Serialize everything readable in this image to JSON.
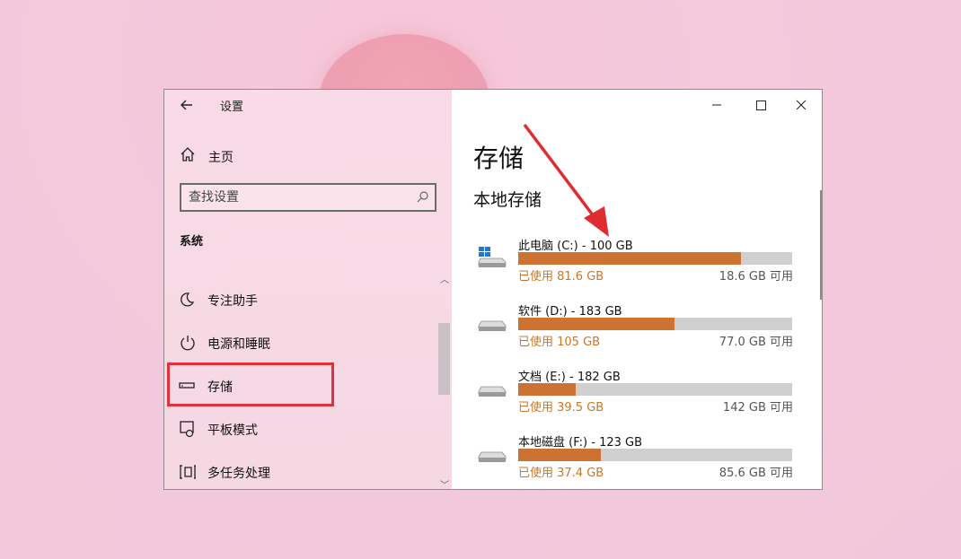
{
  "window": {
    "title": "设置"
  },
  "sidebar": {
    "home_label": "主页",
    "search_placeholder": "查找设置",
    "section_label": "系统",
    "items": [
      {
        "label": "专注助手",
        "icon": "moon-icon"
      },
      {
        "label": "电源和睡眠",
        "icon": "power-icon"
      },
      {
        "label": "存储",
        "icon": "storage-icon",
        "selected": true
      },
      {
        "label": "平板模式",
        "icon": "tablet-icon"
      },
      {
        "label": "多任务处理",
        "icon": "multitask-icon"
      }
    ]
  },
  "content": {
    "title": "存储",
    "subtitle": "本地存储",
    "drives": [
      {
        "name": "此电脑 (C:) - 100 GB",
        "used": "已使用 81.6 GB",
        "free": "18.6 GB 可用",
        "fraction": 0.814,
        "icon": "windows-drive-icon"
      },
      {
        "name": "软件 (D:) - 183 GB",
        "used": "已使用 105 GB",
        "free": "77.0 GB 可用",
        "fraction": 0.57,
        "icon": "drive-icon"
      },
      {
        "name": "文档 (E:) - 182 GB",
        "used": "已使用 39.5 GB",
        "free": "142 GB 可用",
        "fraction": 0.21,
        "icon": "drive-icon"
      },
      {
        "name": "本地磁盘 (F:) - 123 GB",
        "used": "已使用 37.4 GB",
        "free": "85.6 GB 可用",
        "fraction": 0.3,
        "icon": "drive-icon"
      }
    ]
  },
  "colors": {
    "accent_bar": "#cc7332",
    "used_text": "#c5782a",
    "highlight": "#e0303a",
    "arrow": "#e02b31"
  }
}
